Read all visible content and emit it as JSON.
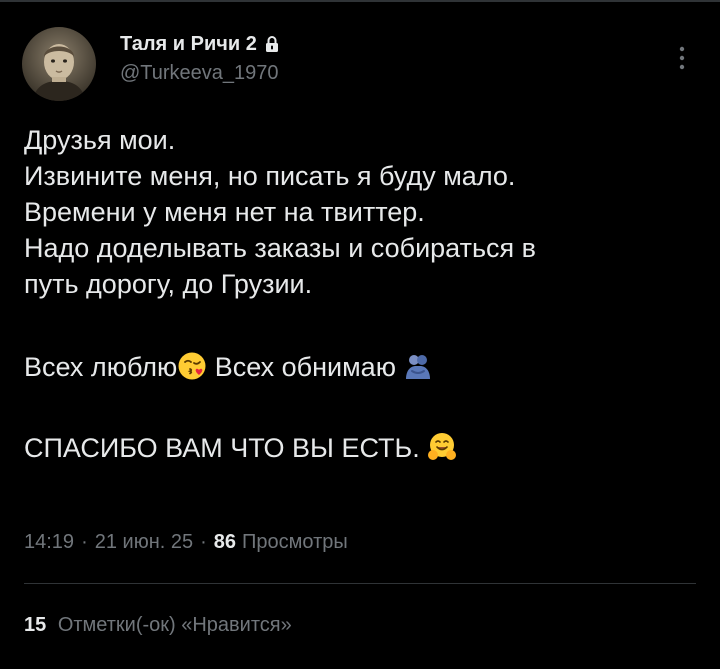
{
  "author": {
    "display_name": "Таля и Ричи 2",
    "handle": "@Turkeeva_1970",
    "protected_icon": "lock-icon",
    "avatar": "vintage-sepia-child-portrait"
  },
  "more_icon": "more-vertical-icon",
  "tweet": {
    "line1": "Друзья мои.",
    "line2": "Извините меня, но писать я буду мало.",
    "line3": "Времени у меня нет на твиттер.",
    "line4": "Надо доделывать заказы и собираться в",
    "line5": "путь дорогу, до Грузии.",
    "line6a": "Всех люблю",
    "emoji_kiss": "face-blowing-a-kiss-emoji",
    "line6b": " Всех обнимаю ",
    "emoji_hug_people": "people-hugging-emoji",
    "line7": "СПАСИБО ВАМ ЧТО ВЫ ЕСТЬ. ",
    "emoji_hugging_face": "hugging-face-emoji"
  },
  "meta": {
    "time": "14:19",
    "separator": "·",
    "date": "21 июн. 25",
    "views_count": "86",
    "views_label": "Просмотры"
  },
  "engagement": {
    "likes_count": "15",
    "likes_label": "Отметки(-ок) «Нравится»"
  },
  "colors": {
    "background": "#000000",
    "text_primary": "#e7e9ea",
    "text_secondary": "#71767b",
    "divider": "#2f3336"
  }
}
